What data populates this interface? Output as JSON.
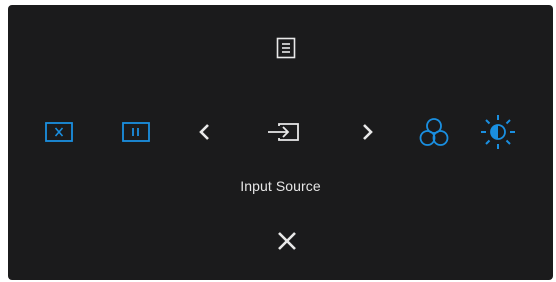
{
  "osd": {
    "selected_label": "Input Source",
    "icons": {
      "menu": "menu-icon",
      "shortcut1": "picture-in-picture-off-icon",
      "shortcut2": "pip-split-icon",
      "prev": "chevron-left-icon",
      "input": "input-source-icon",
      "next": "chevron-right-icon",
      "color": "color-settings-icon",
      "brightness": "brightness-contrast-icon",
      "exit": "close-icon"
    }
  },
  "colors": {
    "panel_bg": "#1b1b1c",
    "icon_white": "#e9e9e9",
    "accent_blue": "#1a8fe0"
  }
}
